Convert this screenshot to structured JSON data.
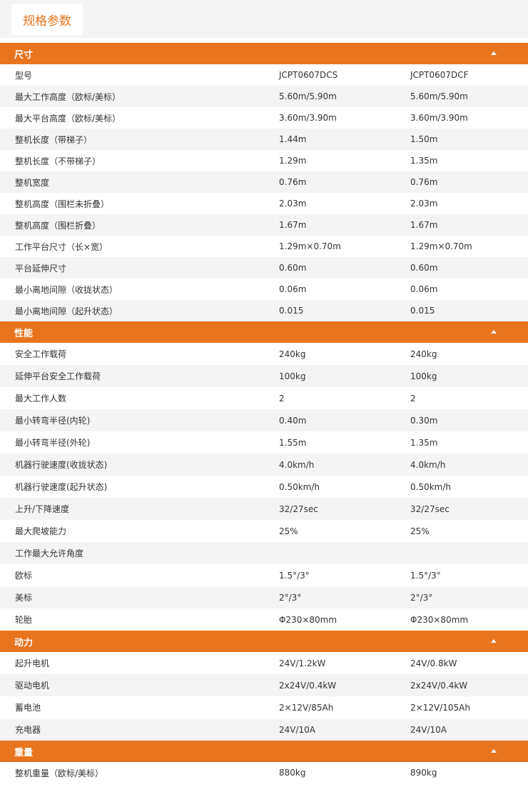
{
  "tab": {
    "label": "规格参数"
  },
  "sections": [
    {
      "title": "尺寸",
      "rows": [
        [
          "型号",
          "JCPT0607DCS",
          "JCPT0607DCF"
        ],
        [
          "最大工作高度（欧标/美标）",
          "5.60m/5.90m",
          "5.60m/5.90m"
        ],
        [
          "最大平台高度（欧标/美标）",
          "3.60m/3.90m",
          "3.60m/3.90m"
        ],
        [
          "整机长度（带梯子）",
          "1.44m",
          "1.50m"
        ],
        [
          "整机长度（不带梯子）",
          "1.29m",
          "1.35m"
        ],
        [
          "整机宽度",
          "0.76m",
          "0.76m"
        ],
        [
          "整机高度（围栏未折叠）",
          "2.03m",
          "2.03m"
        ],
        [
          "整机高度（围栏折叠）",
          "1.67m",
          "1.67m"
        ],
        [
          "工作平台尺寸（长×宽）",
          "1.29m×0.70m",
          "1.29m×0.70m"
        ],
        [
          "平台延伸尺寸",
          "0.60m",
          "0.60m"
        ],
        [
          "最小离地间隙（收拢状态）",
          "0.06m",
          "0.06m"
        ],
        [
          "最小离地间隙（起升状态）",
          "0.015",
          "0.015"
        ]
      ]
    },
    {
      "title": "性能",
      "rows": [
        [
          "安全工作载荷",
          "240kg",
          "240kg"
        ],
        [
          "延伸平台安全工作载荷",
          "100kg",
          "100kg"
        ],
        [
          "最大工作人数",
          "2",
          "2"
        ],
        [
          "最小转弯半径(内轮)",
          "0.40m",
          "0.30m"
        ],
        [
          "最小转弯半径(外轮)",
          "1.55m",
          "1.35m"
        ],
        [
          "机器行驶速度(收拢状态)",
          "4.0km/h",
          "4.0km/h"
        ],
        [
          "机器行驶速度(起升状态)",
          "0.50km/h",
          "0.50km/h"
        ],
        [
          "上升/下降速度",
          "32/27sec",
          "32/27sec"
        ],
        [
          "最大爬坡能力",
          "25%",
          "25%"
        ],
        [
          "工作最大允许角度",
          "",
          ""
        ],
        [
          "欧标",
          "1.5°/3°",
          "1.5°/3°"
        ],
        [
          "美标",
          "2°/3°",
          "2°/3°"
        ],
        [
          "轮胎",
          "Φ230×80mm",
          "Φ230×80mm"
        ]
      ]
    },
    {
      "title": "动力",
      "rows": [
        [
          "起升电机",
          "24V/1.2kW",
          "24V/0.8kW"
        ],
        [
          "驱动电机",
          "2x24V/0.4kW",
          "2x24V/0.4kW"
        ],
        [
          "蓄电池",
          "2×12V/85Ah",
          "2×12V/105Ah"
        ],
        [
          "充电器",
          "24V/10A",
          "24V/10A"
        ]
      ]
    },
    {
      "title": "重量",
      "rows": [
        [
          "整机重量（欧标/美标）",
          "880kg",
          "890kg"
        ]
      ]
    }
  ]
}
